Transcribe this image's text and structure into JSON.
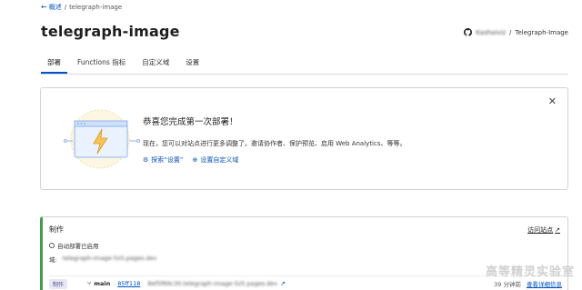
{
  "breadcrumb": {
    "back_label": "概述",
    "separator": "/",
    "current": "telegraph-image"
  },
  "page": {
    "title": "telegraph-image"
  },
  "repo": {
    "icon": "github-icon",
    "owner": "Kashaiviz",
    "name": "Telegraph-Image"
  },
  "tabs": [
    {
      "label": "部署"
    },
    {
      "label": "Functions 指标"
    },
    {
      "label": "自定义域"
    },
    {
      "label": "设置"
    }
  ],
  "success_card": {
    "heading": "恭喜您完成第一次部署！",
    "description": "现在，您可以对站点进行更多调整了。邀请协作者、保护预览、启用 Web Analytics、等等。",
    "link_settings": "探索“设置”",
    "link_domain": "设置自定义域",
    "close_glyph": "✕"
  },
  "production": {
    "title": "制作",
    "visit_label": "访问站点",
    "auto_deploy": "自动部署已启用",
    "domain_label": "域:",
    "domain_value": "telegraph-image-5z5.pages.dev",
    "badge": "制作",
    "branch": "main",
    "commit": "85ff118",
    "deploy_url": "8ef5f69c30.telegraph-image-5z5.pages.dev",
    "ago": "39 分钟前",
    "details_label": "查看详细信息"
  },
  "watermark": "高等精灵实验室",
  "colors": {
    "accent": "#0051c3",
    "production_bar": "#3f9e4b"
  }
}
